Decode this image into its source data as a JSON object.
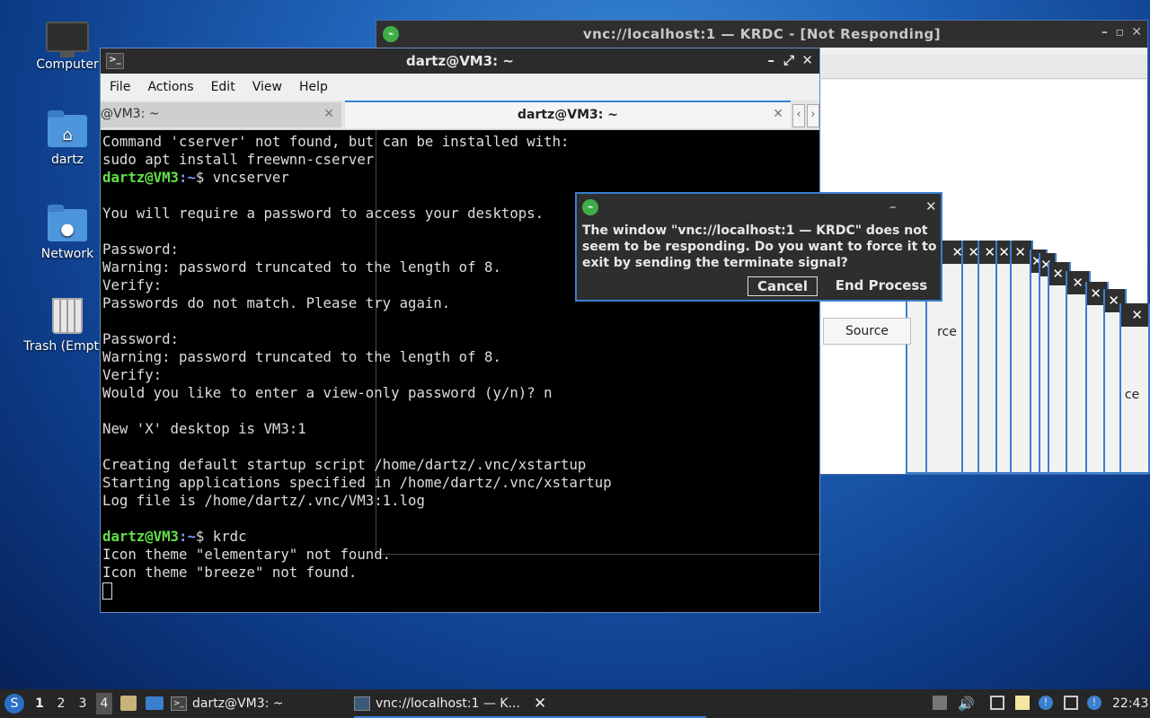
{
  "desktop_icons": [
    {
      "label": "Computer",
      "icon": "computer-icon"
    },
    {
      "label": "dartz",
      "icon": "home-folder-icon"
    },
    {
      "label": "Network",
      "icon": "network-folder-icon"
    },
    {
      "label": "Trash (Empty)",
      "icon": "trash-icon"
    }
  ],
  "krdc": {
    "title": "vnc://localhost:1 — KRDC - [Not Responding]",
    "controls": {
      "minimize": "–",
      "restore": "▫",
      "close": "✕"
    },
    "source_label": "Source",
    "partial_labels": [
      "rce",
      "ce"
    ],
    "close_glyph": "✕"
  },
  "terminal": {
    "title": "dartz@VM3: ~",
    "controls": {
      "minimize": "–",
      "maximize": "⤢",
      "close": "✕"
    },
    "menu": [
      "File",
      "Actions",
      "Edit",
      "View",
      "Help"
    ],
    "tabs": [
      {
        "label": "@VM3: ~",
        "close": "✕"
      },
      {
        "label": "dartz@VM3: ~",
        "close": "✕"
      }
    ],
    "tab_nav": {
      "prev": "‹",
      "next": "›"
    },
    "lines": [
      {
        "text": "Command 'cserver' not found, but can be installed with:"
      },
      {
        "text": "sudo apt install freewnn-cserver"
      },
      {
        "user": "dartz@VM3",
        "path": ":~",
        "cmd": "$ vncserver"
      },
      {
        "text": ""
      },
      {
        "text": "You will require a password to access your desktops."
      },
      {
        "text": ""
      },
      {
        "text": "Password:"
      },
      {
        "text": "Warning: password truncated to the length of 8."
      },
      {
        "text": "Verify:"
      },
      {
        "text": "Passwords do not match. Please try again."
      },
      {
        "text": ""
      },
      {
        "text": "Password:"
      },
      {
        "text": "Warning: password truncated to the length of 8."
      },
      {
        "text": "Verify:"
      },
      {
        "text": "Would you like to enter a view-only password (y/n)? n"
      },
      {
        "text": ""
      },
      {
        "text": "New 'X' desktop is VM3:1"
      },
      {
        "text": ""
      },
      {
        "text": "Creating default startup script /home/dartz/.vnc/xstartup"
      },
      {
        "text": "Starting applications specified in /home/dartz/.vnc/xstartup"
      },
      {
        "text": "Log file is /home/dartz/.vnc/VM3:1.log"
      },
      {
        "text": ""
      },
      {
        "user": "dartz@VM3",
        "path": ":~",
        "cmd": "$ krdc"
      },
      {
        "text": "Icon theme \"elementary\" not found."
      },
      {
        "text": "Icon theme \"breeze\" not found."
      }
    ]
  },
  "dialog": {
    "message": "The window \"vnc://localhost:1 — KRDC\" does not seem to be responding.  Do you want to force it to exit by sending the terminate signal?",
    "cancel_label": "Cancel",
    "end_label": "End Process",
    "controls": {
      "minimize": "–",
      "close": "✕"
    }
  },
  "taskbar": {
    "workspaces": [
      "1",
      "2",
      "3",
      "4"
    ],
    "tasks": [
      {
        "label": "dartz@VM3: ~",
        "icon": "terminal-icon"
      },
      {
        "label": "vnc://localhost:1 — K...",
        "icon": "krdc-icon"
      }
    ],
    "close_glyph": "✕",
    "clock": "22:43"
  }
}
